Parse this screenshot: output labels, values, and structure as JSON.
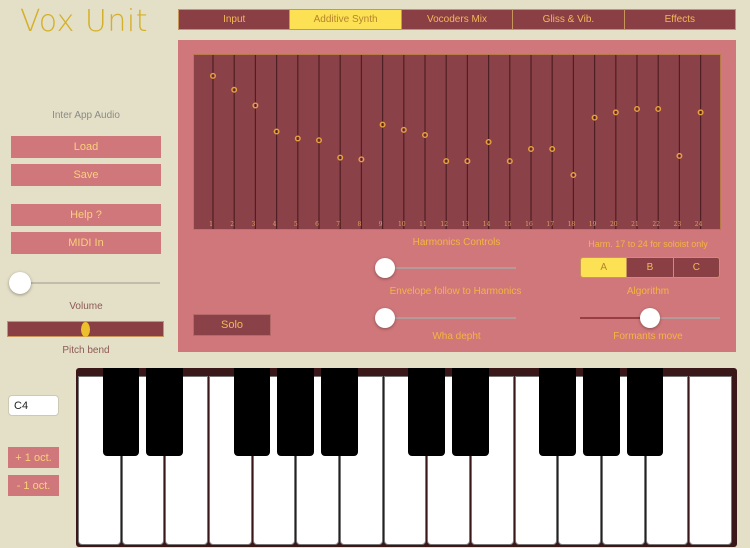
{
  "app": {
    "title": "Vox Unit"
  },
  "tabs": [
    {
      "label": "Input",
      "active": false
    },
    {
      "label": "Additive Synth",
      "active": true
    },
    {
      "label": "Vocoders Mix",
      "active": false
    },
    {
      "label": "Gliss & Vib.",
      "active": false
    },
    {
      "label": "Effects",
      "active": false
    }
  ],
  "sidebar": {
    "inter_app_audio_label": "Inter App Audio",
    "load_label": "Load",
    "save_label": "Save",
    "help_label": "Help ?",
    "midi_in_label": "MIDI In",
    "volume_label": "Volume",
    "volume_value": 0.0,
    "pitch_bend_label": "Pitch bend",
    "pitch_bend_value": 0.5,
    "note_value": "C4",
    "octave_up_label": "+ 1 oct.",
    "octave_down_label": "- 1 oct."
  },
  "harmonics": {
    "labels": [
      "1",
      "2",
      "3",
      "4",
      "5",
      "6",
      "7",
      "8",
      "9",
      "10",
      "11",
      "12",
      "13",
      "14",
      "15",
      "16",
      "17",
      "18",
      "19",
      "20",
      "21",
      "22",
      "23",
      "24"
    ],
    "levels": [
      0.88,
      0.8,
      0.71,
      0.56,
      0.52,
      0.51,
      0.41,
      0.4,
      0.6,
      0.57,
      0.54,
      0.39,
      0.39,
      0.5,
      0.39,
      0.46,
      0.46,
      0.31,
      0.64,
      0.67,
      0.69,
      0.69,
      0.42,
      0.67
    ],
    "colors": {
      "background": "#8a4147",
      "line": "#4e1f24",
      "dot": "#e8a23c"
    }
  },
  "controls": {
    "harmonics_controls_label": "Harmonics Controls",
    "harmonics_controls_value": 0.0,
    "envelope_label": "Envelope follow to Harmonics",
    "wha_value": 0.0,
    "wha_label": "Wha depht",
    "soloist_note": "Harm. 17 to 24 for soloist only",
    "algorithm_options": [
      "A",
      "B",
      "C"
    ],
    "algorithm_selected": "A",
    "algorithm_label": "Algorithm",
    "formants_value": 0.5,
    "formants_label": "Formants move",
    "solo_label": "Solo"
  },
  "keyboard": {
    "white_keys": 15,
    "black_key_after_white": [
      0,
      1,
      3,
      4,
      5,
      7,
      8,
      10,
      11,
      12
    ]
  }
}
